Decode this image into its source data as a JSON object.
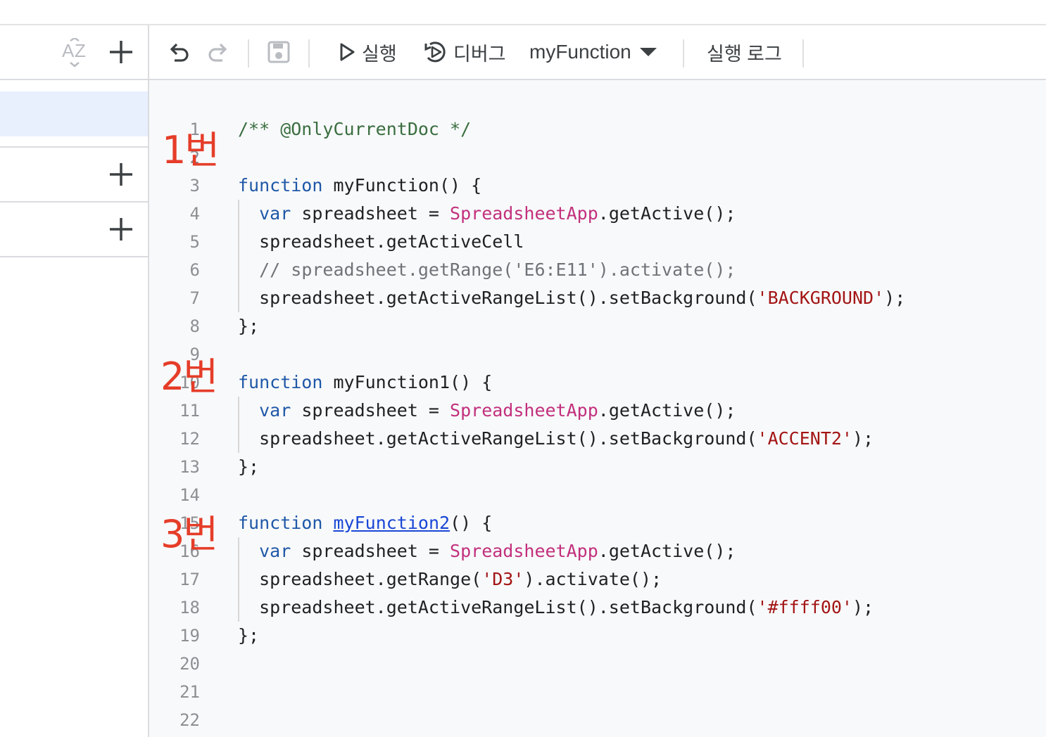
{
  "sidebar": {
    "sort_icon": "sort-az-icon",
    "add_icon": "plus-icon"
  },
  "toolbar": {
    "undo_icon": "undo-icon",
    "redo_icon": "redo-icon",
    "save_icon": "save-icon",
    "run_label": "실행",
    "debug_label": "디버그",
    "function_select": "myFunction",
    "log_label": "실행 로그"
  },
  "annotations": {
    "a1": "1번",
    "a2": "2번",
    "a3": "3번"
  },
  "editor": {
    "lines": [
      {
        "n": "1",
        "guide": false,
        "tokens": [
          {
            "c": "t-cm",
            "t": "/** @OnlyCurrentDoc */"
          }
        ]
      },
      {
        "n": "2",
        "guide": false,
        "tokens": []
      },
      {
        "n": "3",
        "guide": false,
        "tokens": [
          {
            "c": "t-kw",
            "t": "function"
          },
          {
            "c": "",
            "t": " myFunction() {"
          }
        ]
      },
      {
        "n": "4",
        "guide": true,
        "tokens": [
          {
            "c": "",
            "t": "  "
          },
          {
            "c": "t-kw",
            "t": "var"
          },
          {
            "c": "",
            "t": " spreadsheet = "
          },
          {
            "c": "t-cls",
            "t": "SpreadsheetApp"
          },
          {
            "c": "",
            "t": ".getActive();"
          }
        ]
      },
      {
        "n": "5",
        "guide": true,
        "tokens": [
          {
            "c": "",
            "t": "  spreadsheet.getActiveCell"
          }
        ]
      },
      {
        "n": "6",
        "guide": true,
        "tokens": [
          {
            "c": "",
            "t": "  "
          },
          {
            "c": "t-gc",
            "t": "// spreadsheet.getRange('E6:E11').activate();"
          }
        ]
      },
      {
        "n": "7",
        "guide": true,
        "tokens": [
          {
            "c": "",
            "t": "  spreadsheet.getActiveRangeList().setBackground("
          },
          {
            "c": "t-str",
            "t": "'BACKGROUND'"
          },
          {
            "c": "",
            "t": ");"
          }
        ]
      },
      {
        "n": "8",
        "guide": false,
        "tokens": [
          {
            "c": "",
            "t": "};"
          }
        ]
      },
      {
        "n": "9",
        "guide": false,
        "tokens": []
      },
      {
        "n": "10",
        "guide": false,
        "tokens": [
          {
            "c": "t-kw",
            "t": "function"
          },
          {
            "c": "",
            "t": " myFunction1() {"
          }
        ]
      },
      {
        "n": "11",
        "guide": true,
        "tokens": [
          {
            "c": "",
            "t": "  "
          },
          {
            "c": "t-kw",
            "t": "var"
          },
          {
            "c": "",
            "t": " spreadsheet = "
          },
          {
            "c": "t-cls",
            "t": "SpreadsheetApp"
          },
          {
            "c": "",
            "t": ".getActive();"
          }
        ]
      },
      {
        "n": "12",
        "guide": true,
        "tokens": [
          {
            "c": "",
            "t": "  spreadsheet.getActiveRangeList().setBackground("
          },
          {
            "c": "t-str",
            "t": "'ACCENT2'"
          },
          {
            "c": "",
            "t": ");"
          }
        ]
      },
      {
        "n": "13",
        "guide": false,
        "tokens": [
          {
            "c": "",
            "t": "};"
          }
        ]
      },
      {
        "n": "14",
        "guide": false,
        "tokens": []
      },
      {
        "n": "15",
        "guide": false,
        "tokens": [
          {
            "c": "t-kw",
            "t": "function"
          },
          {
            "c": "",
            "t": " "
          },
          {
            "c": "t-link",
            "t": "myFunction2"
          },
          {
            "c": "",
            "t": "() {"
          }
        ]
      },
      {
        "n": "16",
        "guide": true,
        "tokens": [
          {
            "c": "",
            "t": "  "
          },
          {
            "c": "t-kw",
            "t": "var"
          },
          {
            "c": "",
            "t": " spreadsheet = "
          },
          {
            "c": "t-cls",
            "t": "SpreadsheetApp"
          },
          {
            "c": "",
            "t": ".getActive();"
          }
        ]
      },
      {
        "n": "17",
        "guide": true,
        "tokens": [
          {
            "c": "",
            "t": "  spreadsheet.getRange("
          },
          {
            "c": "t-str",
            "t": "'D3'"
          },
          {
            "c": "",
            "t": ").activate();"
          }
        ]
      },
      {
        "n": "18",
        "guide": true,
        "tokens": [
          {
            "c": "",
            "t": "  spreadsheet.getActiveRangeList().setBackground("
          },
          {
            "c": "t-str",
            "t": "'#ffff00'"
          },
          {
            "c": "",
            "t": ");"
          }
        ]
      },
      {
        "n": "19",
        "guide": false,
        "tokens": [
          {
            "c": "",
            "t": "};"
          }
        ]
      },
      {
        "n": "20",
        "guide": false,
        "tokens": []
      },
      {
        "n": "21",
        "guide": false,
        "tokens": []
      },
      {
        "n": "22",
        "guide": false,
        "tokens": []
      }
    ]
  }
}
